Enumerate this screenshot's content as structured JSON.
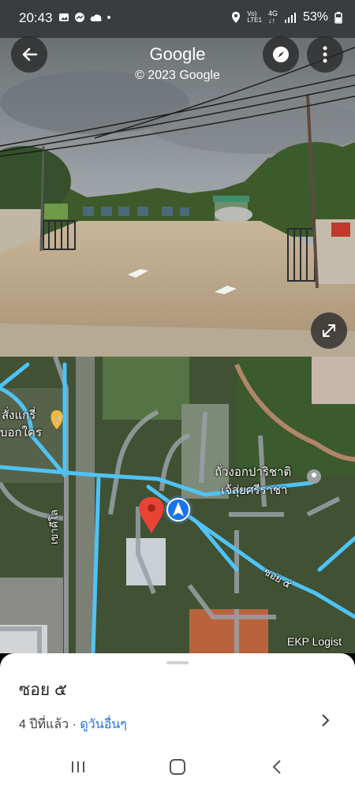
{
  "status": {
    "time": "20:43",
    "battery": "53%",
    "network": "4G"
  },
  "header": {
    "title": "Google",
    "copyright": "© 2023 Google"
  },
  "icons": {
    "back": "arrow-back-icon",
    "compass": "compass-icon",
    "more": "more-vert-icon",
    "expand": "expand-icon"
  },
  "map": {
    "labels": {
      "restaurant_line1": "สั่งแกรี่",
      "restaurant_line2": "บอกใคร",
      "place_line1": "ถั่วงอกปาริชาติ",
      "place_line2": "เจ้สุ่ยศรีราชา",
      "road_1": "เขาคีโล",
      "road_2": "ซอย ๕",
      "company": "EKP Logist"
    },
    "road_color": "#4fc3f7",
    "pin_color": "#ea4335",
    "accent": "#1a73e8"
  },
  "sheet": {
    "title": "ซอย ๕",
    "age": "4 ปีที่แล้ว",
    "separator": " · ",
    "more_link": "ดูวันอื่นๆ"
  }
}
